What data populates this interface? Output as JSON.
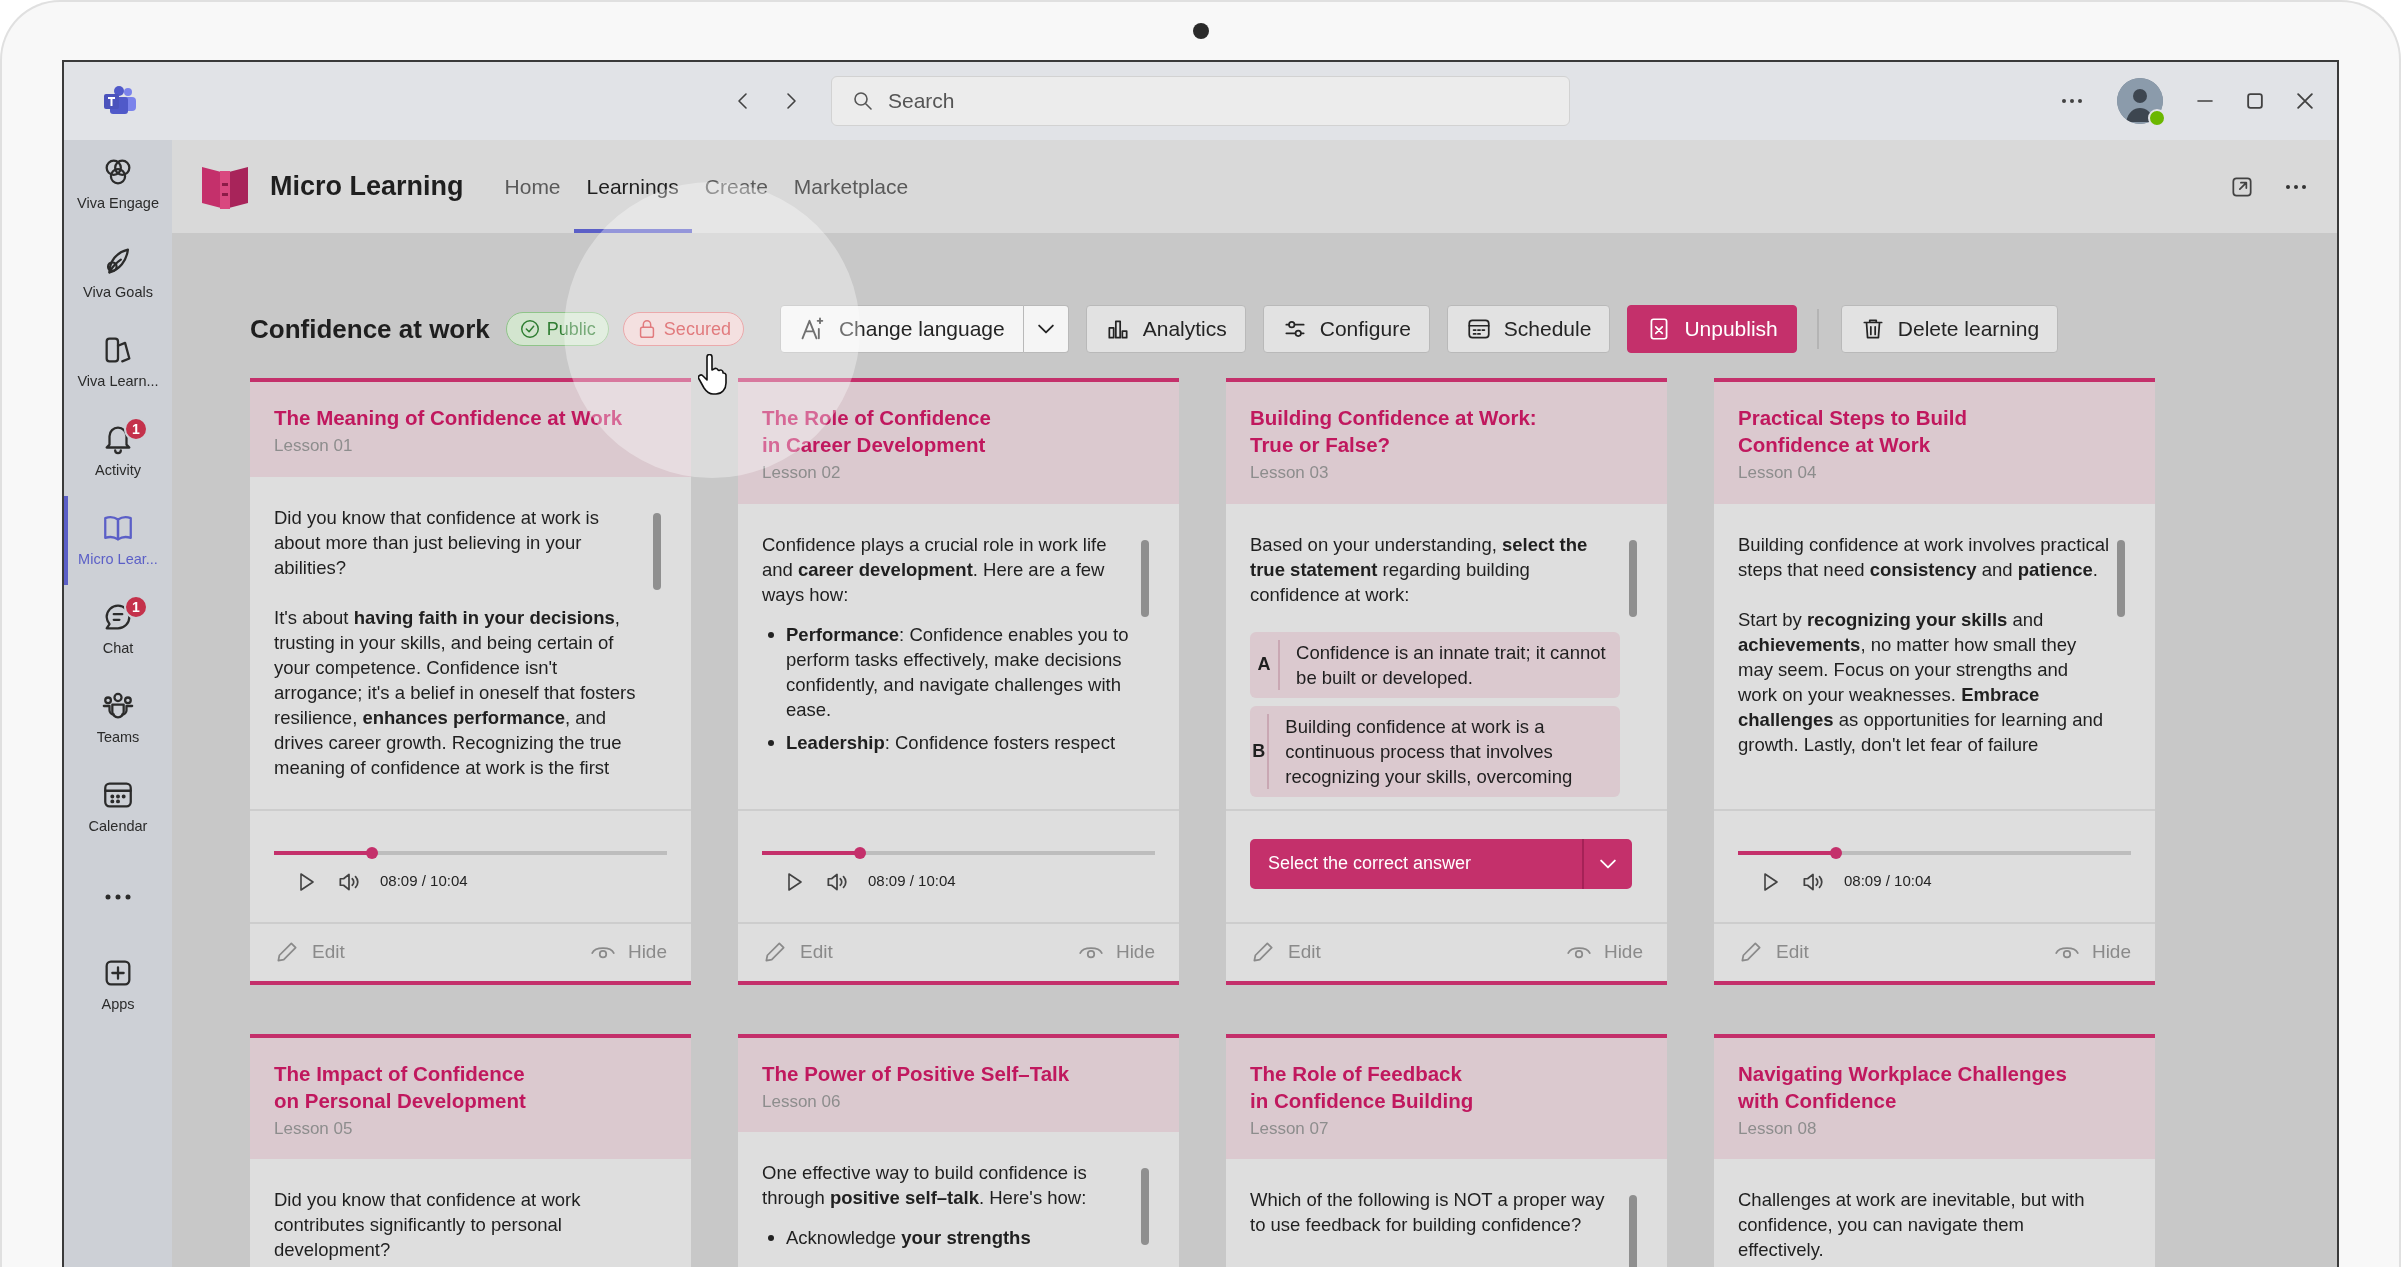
{
  "title_bar": {
    "search_placeholder": "Search"
  },
  "sidebar": {
    "items": [
      {
        "kind": "engage",
        "label": "Viva Engage",
        "selected": false
      },
      {
        "kind": "goals",
        "label": "Viva Goals",
        "selected": false
      },
      {
        "kind": "learning",
        "label": "Viva Learn...",
        "selected": false
      },
      {
        "kind": "activity",
        "label": "Activity",
        "selected": false,
        "badge": "1"
      },
      {
        "kind": "micro",
        "label": "Micro Lear...",
        "selected": true
      },
      {
        "kind": "chat",
        "label": "Chat",
        "selected": false,
        "badge": "1"
      },
      {
        "kind": "teams",
        "label": "Teams",
        "selected": false
      },
      {
        "kind": "calendar",
        "label": "Calendar",
        "selected": false
      },
      {
        "kind": "more",
        "selected": false
      },
      {
        "kind": "apps",
        "label": "Apps",
        "selected": false
      }
    ]
  },
  "app": {
    "name": "Micro Learning",
    "tabs": [
      {
        "label": "Home",
        "selected": false
      },
      {
        "label": "Learnings",
        "selected": true
      },
      {
        "label": "Create",
        "selected": false
      },
      {
        "label": "Marketplace",
        "selected": false
      }
    ]
  },
  "learning": {
    "title": "Confidence at work",
    "badges": [
      {
        "label": "Public",
        "kind": "public"
      },
      {
        "label": "Secured",
        "kind": "secured"
      }
    ],
    "actions": [
      {
        "label": "Change language",
        "kind": "language",
        "split": true
      },
      {
        "label": "Analytics",
        "kind": "analytics"
      },
      {
        "label": "Configure",
        "kind": "configure"
      },
      {
        "label": "Schedule",
        "kind": "schedule"
      },
      {
        "label": "Unpublish",
        "kind": "unpublish",
        "primary": true
      },
      {
        "label": "Delete learning",
        "kind": "delete",
        "separated": true
      }
    ]
  },
  "cards": [
    {
      "title": "The Meaning of Confidence at Work",
      "lesson": "Lesson 01",
      "scrollable": true,
      "body": [
        {
          "kind": "p",
          "text": "Did you know that confidence at work is about more than just believing in your abilities?"
        },
        {
          "kind": "p",
          "text": "It's about **having faith in your decisions**, trusting in your skills, and being certain of your competence. Confidence isn't arrogance; it's a belief in oneself that fosters resilience, **enhances performance**, and drives career growth. Recognizing the true meaning of confidence at work is the first"
        }
      ],
      "player": {
        "level": 0.25,
        "time": "08:09 / 10:04"
      },
      "edit": "Edit",
      "hide": "Hide"
    },
    {
      "title": "The Role of Confidence\nin Career Development",
      "lesson": "Lesson 02",
      "scrollable": true,
      "body": [
        {
          "kind": "p",
          "text": "Confidence plays a crucial role in work life and **career development**. Here are a few ways how:"
        },
        {
          "kind": "list",
          "items": [
            "**Performance**: Confidence enables you to perform tasks effectively, make decisions confidently, and navigate challenges with ease.",
            "**Leadership**: Confidence fosters respect"
          ]
        }
      ],
      "player": {
        "level": 0.25,
        "time": "08:09 / 10:04"
      },
      "edit": "Edit",
      "hide": "Hide"
    },
    {
      "title": "Building Confidence at Work:\nTrue or False?",
      "lesson": "Lesson 03",
      "scrollable": true,
      "body": [
        {
          "kind": "p",
          "text": "Based on your understanding, **select the true statement** regarding building confidence at work:"
        }
      ],
      "options": [
        {
          "letter": "A",
          "text": "Confidence is an innate trait; it cannot be built or developed."
        },
        {
          "letter": "B",
          "text": "Building confidence at work is a continuous process that involves recognizing your skills, overcoming"
        }
      ],
      "answer_button": "Select the correct answer",
      "edit": "Edit",
      "hide": "Hide"
    },
    {
      "title": "Practical Steps to Build\nConfidence at Work",
      "lesson": "Lesson 04",
      "scrollable": true,
      "body": [
        {
          "kind": "p",
          "text": "Building confidence at work involves practical steps that need **consistency** and **patience**."
        },
        {
          "kind": "p",
          "text": "Start by **recognizing your skills** and **achievements**, no matter how small they may seem. Focus on your strengths and work on your weaknesses. **Embrace challenges** as opportunities for learning and growth. Lastly, don't let fear of failure"
        }
      ],
      "player": {
        "level": 0.25,
        "time": "08:09 / 10:04"
      },
      "edit": "Edit",
      "hide": "Hide"
    },
    {
      "title": "The Impact of Confidence\non Personal Development",
      "lesson": "Lesson 05",
      "scrollable": false,
      "body": [
        {
          "kind": "p",
          "text": "Did you know that confidence at work contributes significantly to personal development?"
        }
      ]
    },
    {
      "title": "The Power of Positive Self–Talk",
      "lesson": "Lesson 06",
      "scrollable": true,
      "body": [
        {
          "kind": "p",
          "text": "One effective way to build confidence is through **positive self–talk**. Here's how:"
        },
        {
          "kind": "list",
          "items": [
            "Acknowledge **your strengths**"
          ]
        }
      ]
    },
    {
      "title": "The Role of Feedback\nin Confidence Building",
      "lesson": "Lesson 07",
      "scrollable": true,
      "body": [
        {
          "kind": "p",
          "text": "Which of the following is NOT a proper way to use feedback for building confidence?"
        }
      ]
    },
    {
      "title": "Navigating Workplace Challenges\nwith Confidence",
      "lesson": "Lesson 08",
      "scrollable": false,
      "body": [
        {
          "kind": "p",
          "text": "Challenges at work are inevitable, but with confidence, you can navigate them effectively."
        }
      ]
    }
  ]
}
